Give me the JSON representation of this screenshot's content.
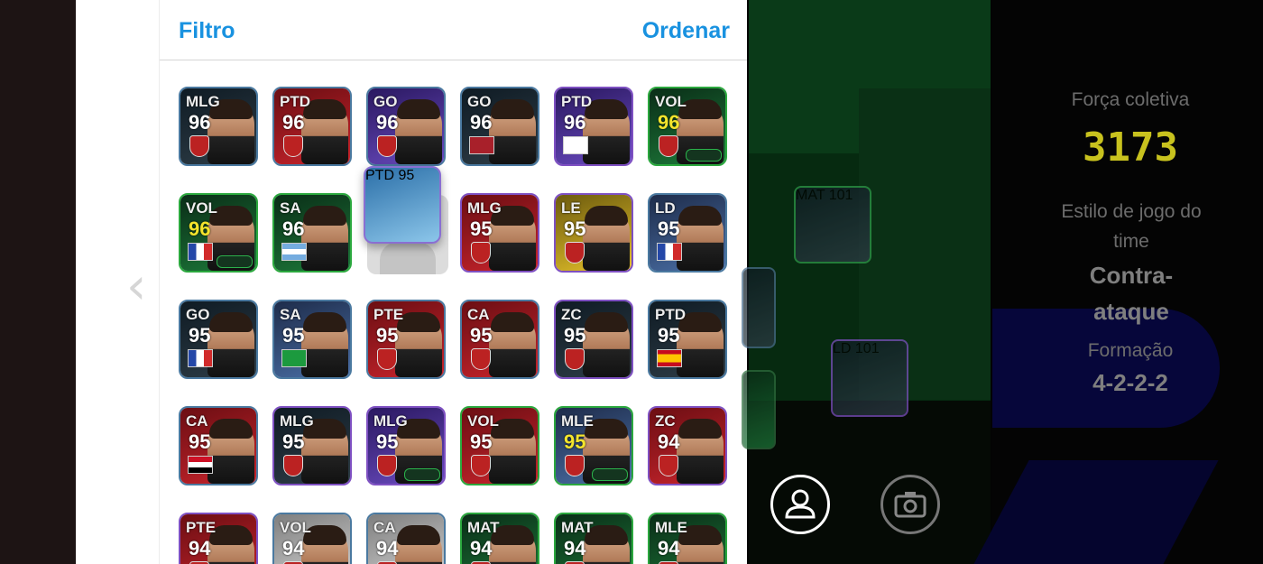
{
  "header": {
    "filter_label": "Filtro",
    "sort_label": "Ordenar"
  },
  "players": [
    {
      "pos": "MLG",
      "rating": "96",
      "bg": "bg-dark",
      "border": "b-blue",
      "badge": "crest"
    },
    {
      "pos": "PTD",
      "rating": "96",
      "bg": "bg-red",
      "border": "b-blue",
      "badge": "crest"
    },
    {
      "pos": "GO",
      "rating": "96",
      "bg": "bg-purple",
      "border": "b-blue",
      "badge": "crest"
    },
    {
      "pos": "GO",
      "rating": "96",
      "bg": "bg-dark",
      "border": "b-blue",
      "badge": "ma"
    },
    {
      "pos": "PTD",
      "rating": "96",
      "bg": "bg-purple",
      "border": "b-purple",
      "badge": "en"
    },
    {
      "pos": "VOL",
      "rating": "96",
      "bg": "bg-green",
      "border": "b-green",
      "badge": "crest",
      "gold": true,
      "tag": true
    },
    {
      "pos": "VOL",
      "rating": "96",
      "bg": "bg-green",
      "border": "b-green",
      "badge": "fr",
      "gold": true,
      "tag": true
    },
    {
      "pos": "SA",
      "rating": "96",
      "bg": "bg-green",
      "border": "b-green",
      "badge": "ar"
    },
    {
      "pos": "MLG",
      "rating": "95",
      "bg": "bg-red",
      "border": "b-purple",
      "badge": "crest"
    },
    {
      "pos": "LE",
      "rating": "95",
      "bg": "bg-yellow",
      "border": "b-purple",
      "badge": "crest"
    },
    {
      "pos": "LD",
      "rating": "95",
      "bg": "bg-blue",
      "border": "b-blue",
      "badge": "fr"
    },
    {
      "pos": "GO",
      "rating": "95",
      "bg": "bg-dark",
      "border": "b-blue",
      "badge": "fr"
    },
    {
      "pos": "SA",
      "rating": "95",
      "bg": "bg-blue",
      "border": "b-blue",
      "badge": "br"
    },
    {
      "pos": "PTE",
      "rating": "95",
      "bg": "bg-red",
      "border": "b-blue",
      "badge": "crest"
    },
    {
      "pos": "CA",
      "rating": "95",
      "bg": "bg-red",
      "border": "b-blue",
      "badge": "crest"
    },
    {
      "pos": "ZC",
      "rating": "95",
      "bg": "bg-dark",
      "border": "b-purple",
      "badge": "crest"
    },
    {
      "pos": "PTD",
      "rating": "95",
      "bg": "bg-dark",
      "border": "b-blue",
      "badge": "es"
    },
    {
      "pos": "CA",
      "rating": "95",
      "bg": "bg-red",
      "border": "b-blue",
      "badge": "eg"
    },
    {
      "pos": "MLG",
      "rating": "95",
      "bg": "bg-dark",
      "border": "b-purple",
      "badge": "crest"
    },
    {
      "pos": "MLG",
      "rating": "95",
      "bg": "bg-purple",
      "border": "b-purple",
      "badge": "crest",
      "tag": true
    },
    {
      "pos": "VOL",
      "rating": "95",
      "bg": "bg-red",
      "border": "b-green",
      "badge": "crest"
    },
    {
      "pos": "MLE",
      "rating": "95",
      "bg": "bg-blue",
      "border": "b-green",
      "badge": "crest",
      "gold": true,
      "tag": true
    },
    {
      "pos": "ZC",
      "rating": "94",
      "bg": "bg-red",
      "border": "b-purple",
      "badge": "crest"
    },
    {
      "pos": "PTE",
      "rating": "94",
      "bg": "bg-red",
      "border": "b-purple",
      "badge": "crest"
    },
    {
      "pos": "VOL",
      "rating": "94",
      "bg": "bg-grey",
      "border": "b-blue",
      "badge": "crest"
    },
    {
      "pos": "CA",
      "rating": "94",
      "bg": "bg-grey",
      "border": "b-blue",
      "badge": "crest"
    },
    {
      "pos": "MAT",
      "rating": "94",
      "bg": "bg-green",
      "border": "b-green",
      "badge": "crest"
    },
    {
      "pos": "MAT",
      "rating": "94",
      "bg": "bg-green",
      "border": "b-green",
      "badge": "crest"
    },
    {
      "pos": "MLE",
      "rating": "94",
      "bg": "bg-green",
      "border": "b-green",
      "badge": "crest"
    }
  ],
  "dragging_player": {
    "pos": "PTD",
    "rating": "95",
    "badge": "ar"
  },
  "pitch_players": [
    {
      "pos": "MAT",
      "rating": "101"
    },
    {
      "pos": "LD",
      "rating": "101"
    }
  ],
  "team": {
    "strength_label": "Força coletiva",
    "strength_value": "3173",
    "style_label": "Estilo de jogo do time",
    "style_value": "Contra-ataque",
    "formation_label": "Formação",
    "formation_value": "4-2-2-2"
  },
  "icons": {
    "back": "chevron-left-icon",
    "player": "person-icon",
    "camera": "camera-icon"
  },
  "colors": {
    "accent": "#1992e0",
    "strength": "#c8c21e",
    "gold_rating": "#f3e42c"
  }
}
